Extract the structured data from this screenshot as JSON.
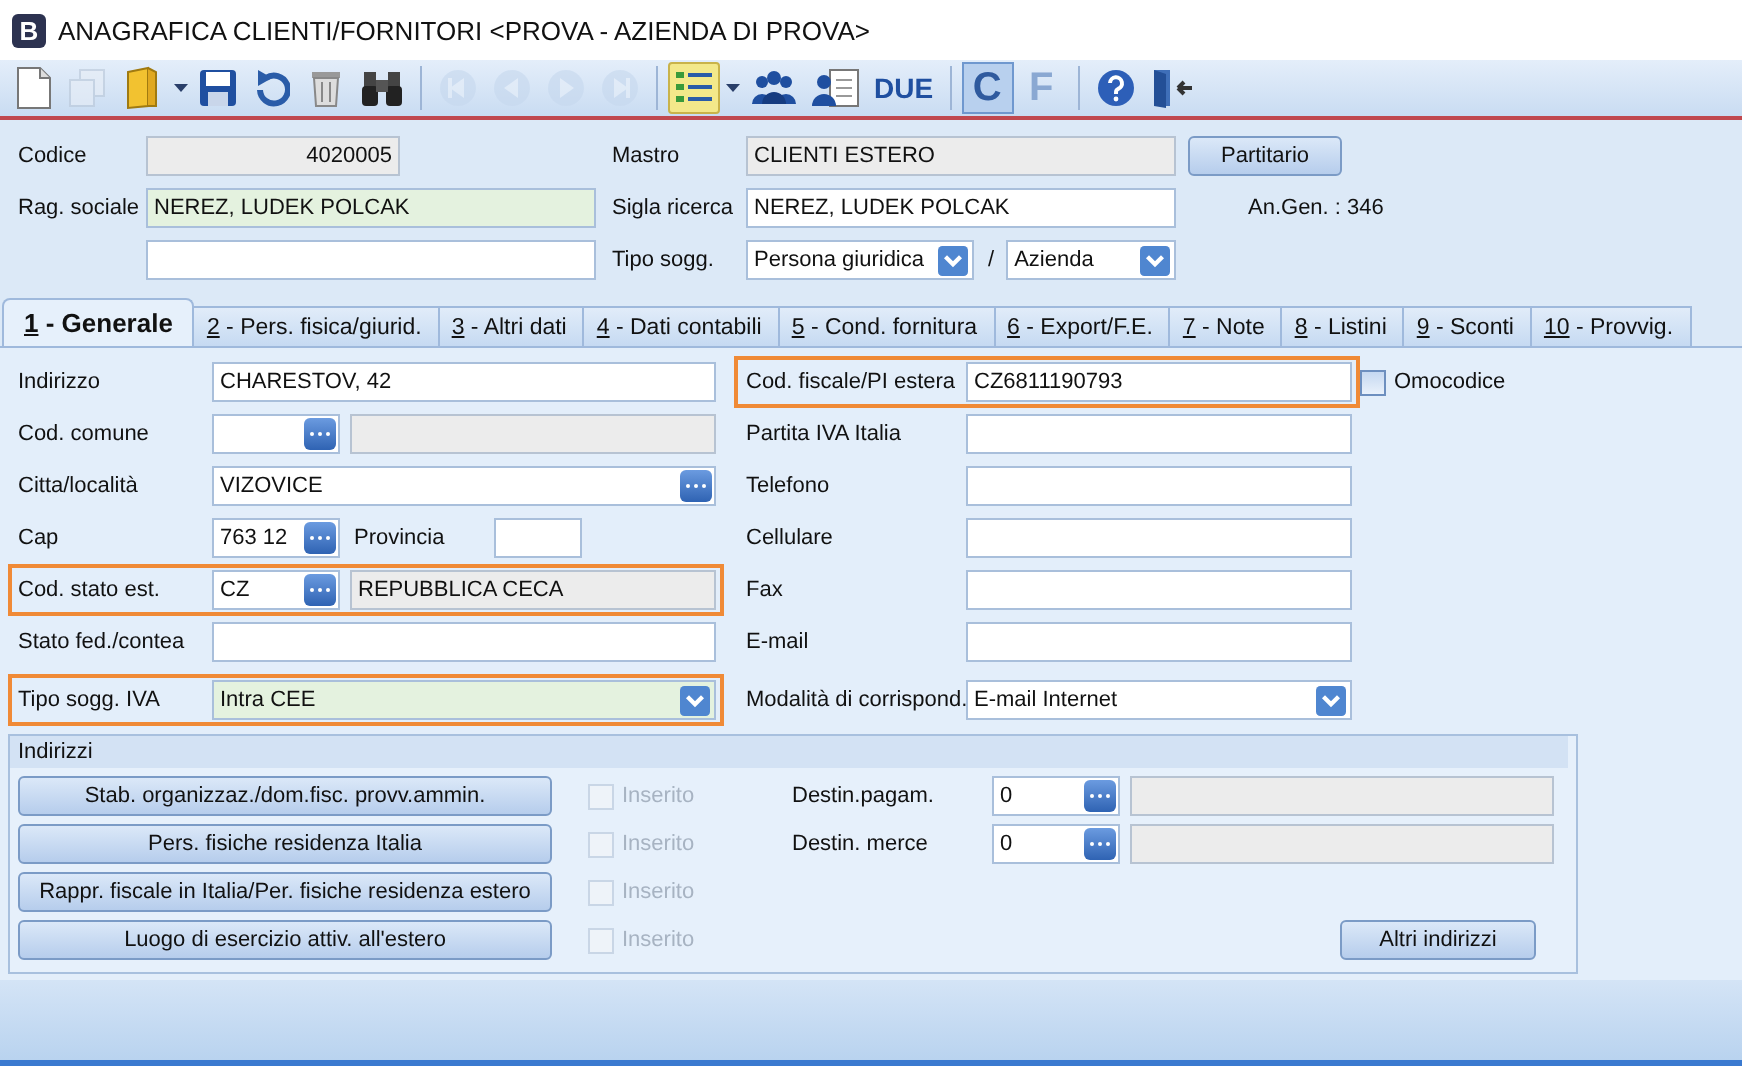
{
  "window": {
    "badge": "B",
    "title": "ANAGRAFICA CLIENTI/FORNITORI <PROVA - AZIENDA DI PROVA>"
  },
  "toolbar": [
    {
      "kind": "new",
      "disabled": false,
      "pressed": false
    },
    {
      "kind": "duplicate",
      "disabled": true,
      "pressed": false
    },
    {
      "kind": "folder",
      "disabled": false,
      "pressed": false
    },
    {
      "kind": "caret",
      "disabled": false,
      "pressed": false
    },
    {
      "kind": "save",
      "disabled": false,
      "pressed": false
    },
    {
      "kind": "undo",
      "disabled": false,
      "pressed": false
    },
    {
      "kind": "delete",
      "disabled": false,
      "pressed": false
    },
    {
      "kind": "find",
      "disabled": false,
      "pressed": false
    },
    {
      "kind": "separator"
    },
    {
      "kind": "first",
      "disabled": true,
      "pressed": false
    },
    {
      "kind": "prev",
      "disabled": true,
      "pressed": false
    },
    {
      "kind": "next",
      "disabled": true,
      "pressed": false
    },
    {
      "kind": "last",
      "disabled": true,
      "pressed": false
    },
    {
      "kind": "separator"
    },
    {
      "kind": "list",
      "disabled": false,
      "pressed": false
    },
    {
      "kind": "caret",
      "disabled": false,
      "pressed": false
    },
    {
      "kind": "people",
      "disabled": false,
      "pressed": false
    },
    {
      "kind": "contact",
      "disabled": false,
      "pressed": false
    },
    {
      "kind": "text",
      "label": "DUE",
      "disabled": false,
      "pressed": false
    },
    {
      "kind": "separator"
    },
    {
      "kind": "text",
      "label": "C",
      "disabled": true,
      "pressed": true
    },
    {
      "kind": "text",
      "label": "F",
      "disabled": true,
      "pressed": false
    },
    {
      "kind": "separator"
    },
    {
      "kind": "help",
      "disabled": false,
      "pressed": false
    },
    {
      "kind": "exit",
      "disabled": false,
      "pressed": false
    }
  ],
  "header": {
    "codice": {
      "label": "Codice",
      "value": "4020005"
    },
    "mastro": {
      "label": "Mastro",
      "value": "CLIENTI ESTERO"
    },
    "partitario_button": "Partitario",
    "rag_sociale": {
      "label": "Rag. sociale",
      "value": "NEREZ, LUDEK POLCAK",
      "mandatory": true
    },
    "sigla_ricerca": {
      "label": "Sigla ricerca",
      "value": "NEREZ, LUDEK POLCAK",
      "mandatory": false
    },
    "an_gen": "An.Gen. : 346",
    "tipo_sogg": {
      "label": "Tipo sogg.",
      "value": "Persona giuridica",
      "separator": "/",
      "value_2": "Azienda"
    }
  },
  "tabs": [
    {
      "key": "1",
      "rest": "- Generale",
      "selected": true
    },
    {
      "key": "2",
      "rest": "- Pers. fisica/giurid.",
      "selected": false
    },
    {
      "key": "3",
      "rest": "- Altri dati",
      "selected": false
    },
    {
      "key": "4",
      "rest": "- Dati contabili",
      "selected": false
    },
    {
      "key": "5",
      "rest": "- Cond. fornitura",
      "selected": false
    },
    {
      "key": "6",
      "rest": "- Export/F.E.",
      "selected": false
    },
    {
      "key": "7",
      "rest": "- Note",
      "selected": false
    },
    {
      "key": "8",
      "rest": "- Listini",
      "selected": false
    },
    {
      "key": "9",
      "rest": "- Sconti",
      "selected": false
    },
    {
      "key": "10",
      "rest": "- Provvig.",
      "selected": false
    }
  ],
  "left_fields": [
    {
      "kind": "text",
      "label": "Indirizzo",
      "value": "CHARESTOV, 42",
      "highlighted": false,
      "mandatory": false
    },
    {
      "kind": "lookup",
      "label": "Cod. comune",
      "highlighted": false,
      "mandatory": false
    },
    {
      "kind": "lookup_wide",
      "label": "Citta/località",
      "value": "VIZOVICE",
      "highlighted": false,
      "mandatory": false
    },
    {
      "kind": "cap",
      "label": "Cap",
      "value": "763 12",
      "second_label": "Provincia",
      "highlighted": false,
      "mandatory": false
    },
    {
      "kind": "lookup",
      "label": "Cod. stato est.",
      "value": "CZ",
      "description": "REPUBBLICA CECA",
      "highlighted": true,
      "mandatory": false
    },
    {
      "kind": "text",
      "label": "Stato fed./contea",
      "highlighted": false,
      "mandatory": false
    },
    {
      "kind": "dropdown",
      "label": "Tipo sogg. IVA",
      "value": "Intra CEE",
      "highlighted": true,
      "mandatory": true
    }
  ],
  "right_fields": [
    {
      "kind": "text",
      "label": "Cod. fiscale/PI estera",
      "value": "CZ6811190793",
      "highlighted": true,
      "mandatory": false,
      "checkbox": {
        "label": "Omocodice",
        "checked": false
      }
    },
    {
      "kind": "text",
      "label": "Partita IVA Italia",
      "highlighted": false,
      "mandatory": false
    },
    {
      "kind": "text",
      "label": "Telefono",
      "highlighted": false,
      "mandatory": false
    },
    {
      "kind": "text",
      "label": "Cellulare",
      "highlighted": false,
      "mandatory": false
    },
    {
      "kind": "text",
      "label": "Fax",
      "highlighted": false,
      "mandatory": false
    },
    {
      "kind": "text",
      "label": "E-mail",
      "highlighted": false,
      "mandatory": false
    },
    {
      "kind": "dropdown",
      "label": "Modalità di corrispond.",
      "value": "E-mail Internet",
      "highlighted": false,
      "mandatory": false
    }
  ],
  "addresses": {
    "title": "Indirizzi",
    "rows": [
      {
        "button": "Stab. organizzaz./dom.fisc. provv.ammin.",
        "check_label": "Inserito",
        "checked": false,
        "disabled": true
      },
      {
        "button": "Pers. fisiche residenza Italia",
        "check_label": "Inserito",
        "checked": false,
        "disabled": true
      },
      {
        "button": "Rappr. fiscale in Italia/Per. fisiche residenza estero",
        "check_label": "Inserito",
        "checked": false,
        "disabled": true
      },
      {
        "button": "Luogo di esercizio attiv. all'estero",
        "check_label": "Inserito",
        "checked": false,
        "disabled": true
      }
    ],
    "destinations": [
      {
        "label": "Destin.pagam.",
        "value": "0"
      },
      {
        "label": "Destin. merce",
        "value": "0"
      }
    ],
    "more_button": "Altri indirizzi"
  }
}
